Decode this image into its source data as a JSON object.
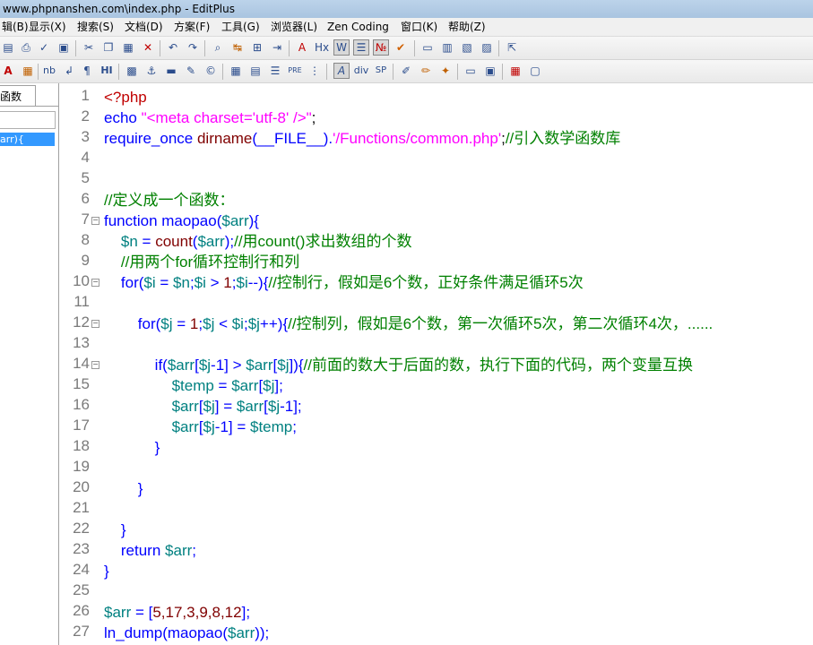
{
  "window": {
    "title": "www.phpnanshen.com\\index.php - EditPlus"
  },
  "menu": [
    "辑(B)",
    "显示(X)",
    "搜索(S)",
    "文档(D)",
    "方案(F)",
    "工具(G)",
    "浏览器(L)",
    "Zen Coding",
    "窗口(K)",
    "帮助(Z)"
  ],
  "toolbar2_labels": {
    "nb": "nb",
    "hx": "Hx",
    "hi": "HI",
    "pre": "PRE",
    "div": "div",
    "sp": "SP",
    "w": "W"
  },
  "sidepanel": {
    "tab": "函数",
    "item": "arr){"
  },
  "line_numbers": [
    "1",
    "2",
    "3",
    "4",
    "5",
    "6",
    "7",
    "8",
    "9",
    "10",
    "11",
    "12",
    "13",
    "14",
    "15",
    "16",
    "17",
    "18",
    "19",
    "20",
    "21",
    "22",
    "23",
    "24",
    "25",
    "26",
    "27"
  ],
  "code": {
    "l1": "<?php",
    "l2a": "echo ",
    "l2b": "\"<meta charset='utf-8' />\"",
    "l2c": ";",
    "l3a": "require_once ",
    "l3b": "dirname",
    "l3c": "(__FILE__).",
    "l3d": "'/Functions/common.php'",
    "l3e": ";",
    "l3f": "//引入数学函数库",
    "l6": "//定义成一个函数：",
    "l7a": "function ",
    "l7b": "maopao",
    "l7c": "(",
    "l7d": "$arr",
    "l7e": "){",
    "l8a": "    ",
    "l8b": "$n",
    "l8c": " = ",
    "l8d": "count",
    "l8e": "(",
    "l8f": "$arr",
    "l8g": ");",
    "l8h": "//用count()求出数组的个数",
    "l9": "    //用两个for循环控制行和列",
    "l10a": "    for(",
    "l10b": "$i",
    "l10c": " = ",
    "l10d": "$n",
    "l10e": ";",
    "l10f": "$i",
    "l10g": " > ",
    "l10h": "1",
    "l10i": ";",
    "l10j": "$i",
    "l10k": "--){",
    "l10l": "//控制行，假如是6个数，正好条件满足循环5次",
    "l12a": "        for(",
    "l12b": "$j",
    "l12c": " = ",
    "l12d": "1",
    "l12e": ";",
    "l12f": "$j",
    "l12g": " < ",
    "l12h": "$i",
    "l12i": ";",
    "l12j": "$j",
    "l12k": "++){",
    "l12l": "//控制列，假如是6个数，第一次循环5次，第二次循环4次，......",
    "l14a": "            if(",
    "l14b": "$arr",
    "l14c": "[",
    "l14d": "$j",
    "l14e": "-1] > ",
    "l14f": "$arr",
    "l14g": "[",
    "l14h": "$j",
    "l14i": "]){",
    "l14j": "//前面的数大于后面的数，执行下面的代码，两个变量互换",
    "l15a": "                ",
    "l15b": "$temp",
    "l15c": " = ",
    "l15d": "$arr",
    "l15e": "[",
    "l15f": "$j",
    "l15g": "];",
    "l16a": "                ",
    "l16b": "$arr",
    "l16c": "[",
    "l16d": "$j",
    "l16e": "] = ",
    "l16f": "$arr",
    "l16g": "[",
    "l16h": "$j",
    "l16i": "-1];",
    "l17a": "                ",
    "l17b": "$arr",
    "l17c": "[",
    "l17d": "$j",
    "l17e": "-1] = ",
    "l17f": "$temp",
    "l17g": ";",
    "l18": "            }",
    "l20": "        }",
    "l22": "    }",
    "l23a": "    return ",
    "l23b": "$arr",
    "l23c": ";",
    "l24": "}",
    "l26a": "$arr",
    "l26b": " = [",
    "l26c": "5,17,3,9,8,12",
    "l26d": "];",
    "l27a": "ln_dump",
    "l27b": "(",
    "l27c": "maopao",
    "l27d": "(",
    "l27e": "$arr",
    "l27f": "));"
  },
  "colors": {
    "keyword": "#0000ff",
    "variable": "#008080",
    "string": "#ff00ff",
    "function": "#800000",
    "comment": "#008000",
    "gutter_text": "#7a7a7a",
    "selection": "#3399ff"
  }
}
